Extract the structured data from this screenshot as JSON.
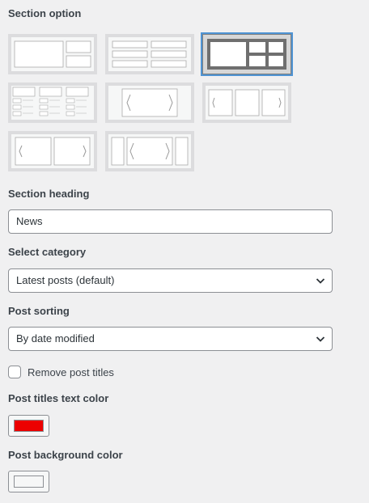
{
  "section_option": {
    "label": "Section option",
    "layouts": [
      {
        "name": "layout-big-left-two-right",
        "selected": false
      },
      {
        "name": "layout-two-column-list",
        "selected": false
      },
      {
        "name": "layout-big-left-grid-right",
        "selected": true
      },
      {
        "name": "layout-three-column-list",
        "selected": false
      },
      {
        "name": "layout-single-slider",
        "selected": false
      },
      {
        "name": "layout-three-slider",
        "selected": false
      },
      {
        "name": "layout-two-slider",
        "selected": false
      },
      {
        "name": "layout-center-slider",
        "selected": false
      }
    ]
  },
  "section_heading": {
    "label": "Section heading",
    "value": "News"
  },
  "select_category": {
    "label": "Select category",
    "value": "Latest posts (default)"
  },
  "post_sorting": {
    "label": "Post sorting",
    "value": "By date modified"
  },
  "remove_titles": {
    "label": "Remove post titles",
    "checked": false
  },
  "post_title_color": {
    "label": "Post titles text color",
    "color": "#ec0000"
  },
  "post_bg_color": {
    "label": "Post background color",
    "color": "#f6f7f7"
  },
  "colors": {
    "accent": "#4f94d4",
    "border": "#8c8f94",
    "background": "#f0f0f1"
  }
}
